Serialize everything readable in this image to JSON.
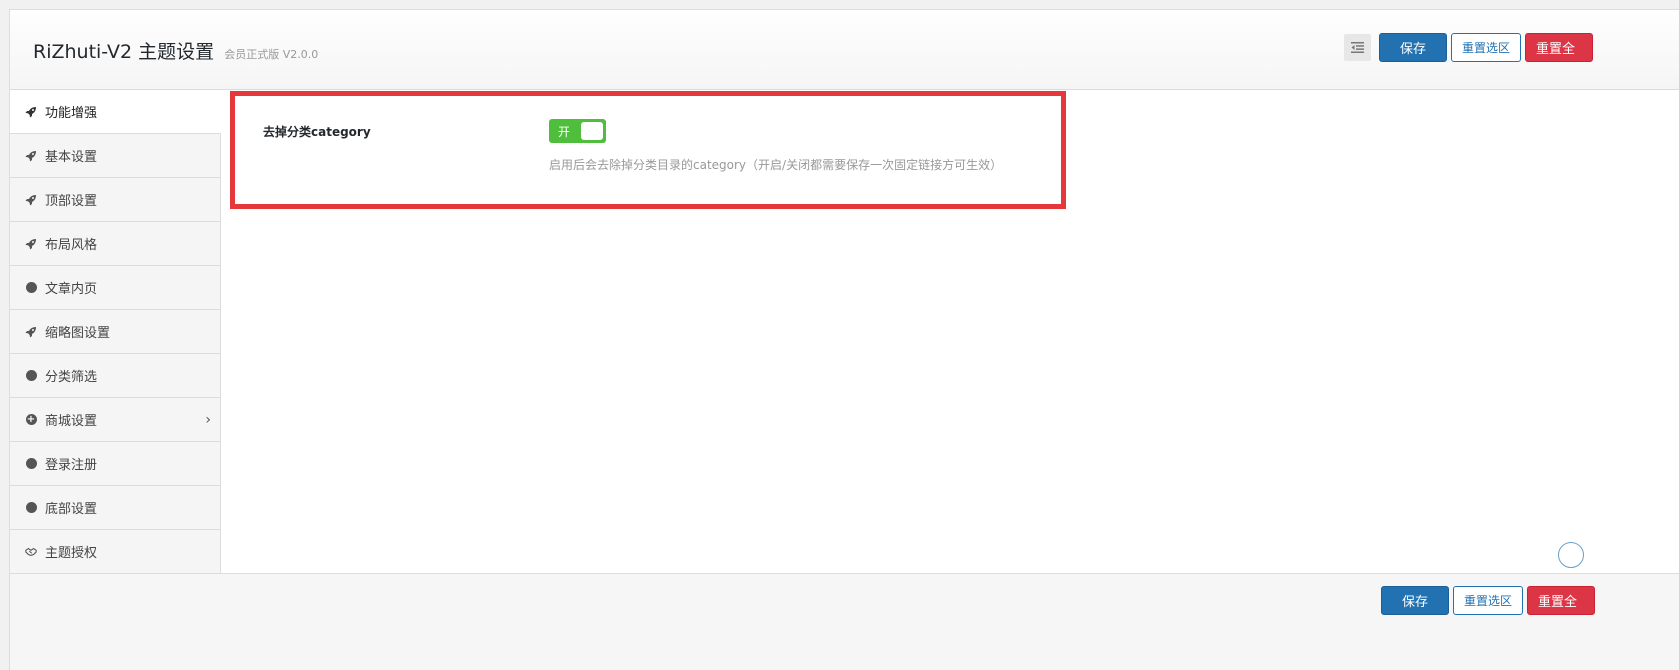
{
  "header": {
    "title": "RiZhuti-V2 主题设置",
    "version": "会员正式版 V2.0.0",
    "expand_icon": "indent-icon",
    "save_label": "保存",
    "reset_section_label": "重置选区",
    "reset_all_label": "重置全"
  },
  "sidebar": {
    "items": [
      {
        "label": "功能增强",
        "icon": "rocket-icon",
        "active": true
      },
      {
        "label": "基本设置",
        "icon": "rocket-icon"
      },
      {
        "label": "顶部设置",
        "icon": "rocket-icon"
      },
      {
        "label": "布局风格",
        "icon": "rocket-icon"
      },
      {
        "label": "文章内页",
        "icon": "circle-icon"
      },
      {
        "label": "缩略图设置",
        "icon": "rocket-icon"
      },
      {
        "label": "分类筛选",
        "icon": "circle-icon"
      },
      {
        "label": "商城设置",
        "icon": "plus-circle-icon",
        "has_children": true
      },
      {
        "label": "登录注册",
        "icon": "circle-icon"
      },
      {
        "label": "底部设置",
        "icon": "circle-icon"
      },
      {
        "label": "主题授权",
        "icon": "handshake-icon"
      }
    ]
  },
  "main": {
    "field_title": "去掉分类category",
    "switch_label": "开",
    "switch_on": true,
    "field_description": "启用后会去除掉分类目录的category（开启/关闭都需要保存一次固定链接方可生效）",
    "highlight_color": "#e5383b"
  },
  "footer": {
    "save_label": "保存",
    "reset_section_label": "重置选区",
    "reset_all_label": "重置全"
  },
  "colors": {
    "primary": "#2271b1",
    "danger": "#dc3545",
    "switch_on": "#4fbe3c"
  }
}
